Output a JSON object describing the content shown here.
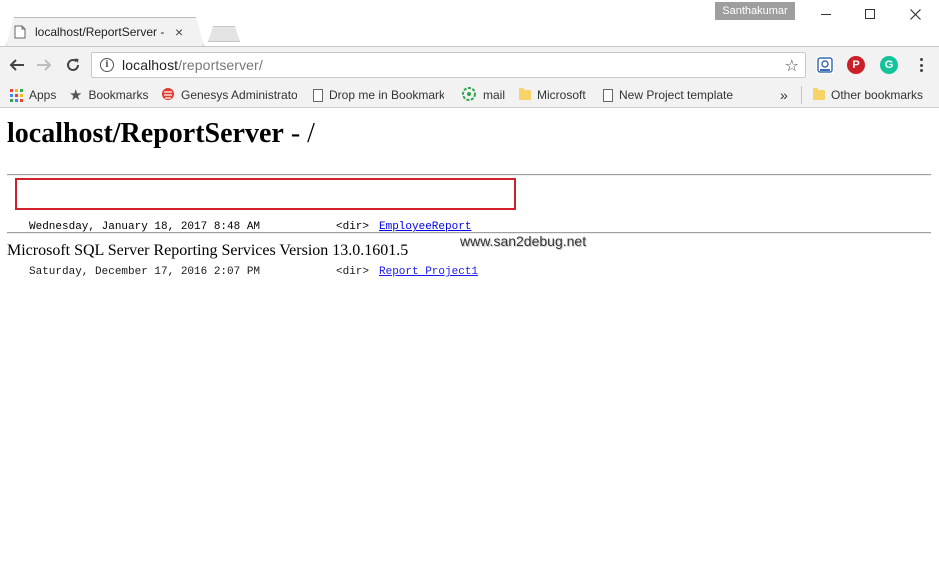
{
  "browser": {
    "tab": {
      "title": "localhost/ReportServer - ",
      "close_glyph": "×"
    },
    "profile_name": "Santhakumar",
    "address": {
      "host": "localhost",
      "path": "/reportserver/"
    },
    "bookmarks": [
      {
        "label": "Apps",
        "icon": "apps-grid-icon"
      },
      {
        "label": "Bookmarks",
        "icon": "star-icon"
      },
      {
        "label": "Genesys Administrato",
        "icon": "genesys-icon"
      },
      {
        "label": "Drop me in Bookmark",
        "icon": "page-icon"
      },
      {
        "label": "mail",
        "icon": "mail-icon"
      },
      {
        "label": "Microsoft",
        "icon": "folder-icon"
      },
      {
        "label": "New Project template",
        "icon": "page-icon"
      }
    ],
    "overflow_glyph": "»",
    "other_bookmarks": "Other bookmarks",
    "colors": {
      "pinterest": "#cb2027",
      "grammarly": "#15c39a",
      "highlight_box": "#d0202e",
      "link": "#0000ee"
    }
  },
  "page": {
    "heading_main": "localhost/ReportServer",
    "heading_rest": " - /",
    "entries": [
      {
        "date": "Wednesday, January 18, 2017 8:48 AM",
        "type": "<dir>",
        "name": "EmployeeReport"
      },
      {
        "date": "Saturday, December 17, 2016 2:07 PM",
        "type": "<dir>",
        "name": "Report Project1"
      }
    ],
    "watermark": "www.san2debug.net",
    "footer": "Microsoft SQL Server Reporting Services Version 13.0.1601.5"
  }
}
